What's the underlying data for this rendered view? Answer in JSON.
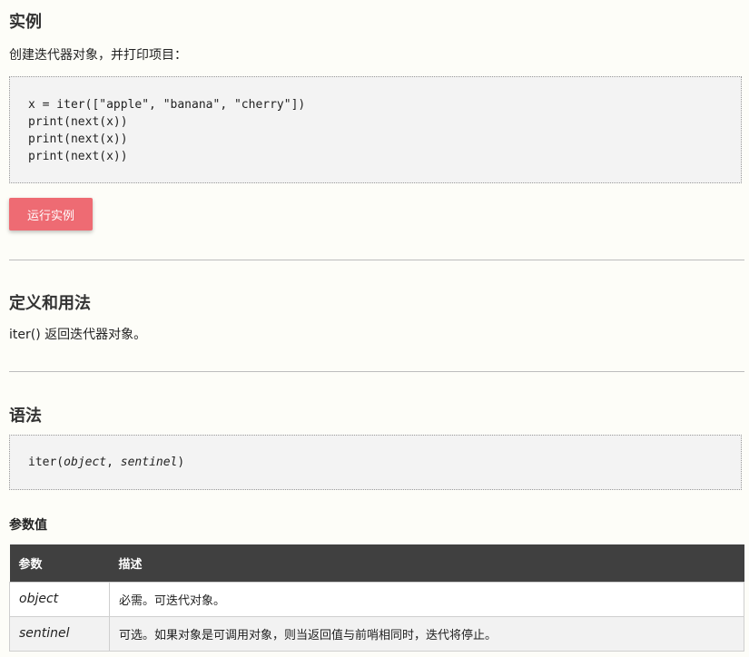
{
  "example": {
    "heading": "实例",
    "intro": "创建迭代器对象，并打印项目：",
    "code_lines": [
      "x = iter([\"apple\", \"banana\", \"cherry\"])",
      "print(next(x))",
      "print(next(x))",
      "print(next(x))"
    ],
    "run_button": "运行实例"
  },
  "definition": {
    "heading": "定义和用法",
    "text": "iter() 返回迭代器对象。"
  },
  "syntax": {
    "heading": "语法",
    "code_prefix": "iter(",
    "arg1": "object",
    "sep": ", ",
    "arg2": "sentinel",
    "code_suffix": ")"
  },
  "params": {
    "heading": "参数值",
    "col_param": "参数",
    "col_desc": "描述",
    "rows": [
      {
        "name": "object",
        "desc": "必需。可迭代对象。"
      },
      {
        "name": "sentinel",
        "desc": "可选。如果对象是可调用对象，则当返回值与前哨相同时，迭代将停止。"
      }
    ]
  },
  "colors": {
    "button": "#ee6b73",
    "table_header": "#404040",
    "page_bg": "#fdfdf8"
  }
}
